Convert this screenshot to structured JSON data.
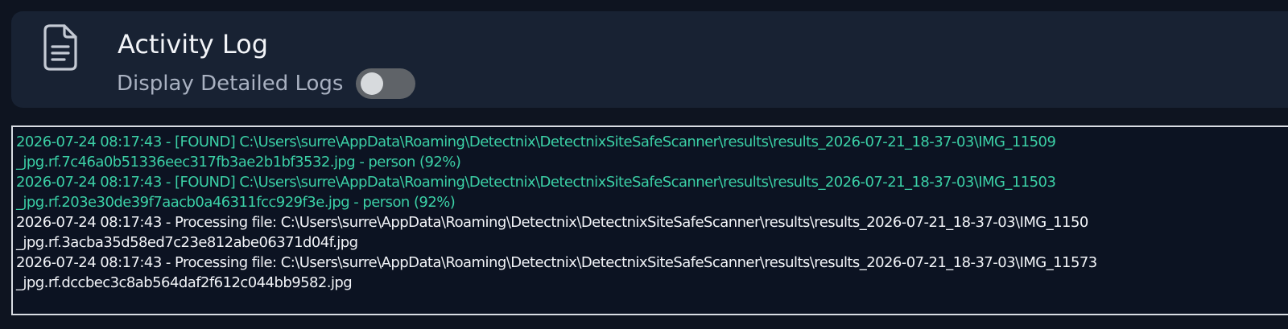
{
  "header": {
    "icon": "document-icon",
    "title": "Activity Log",
    "toggle_label": "Display Detailed Logs",
    "toggle_on": false
  },
  "colors": {
    "found": "#3bd0a6",
    "info": "#f2f4f8",
    "card": "#182233",
    "background": "#0e1420"
  },
  "log": {
    "lines": [
      {
        "type": "found",
        "text": "2026-07-24 08:17:43 - [FOUND] C:\\Users\\surre\\AppData\\Roaming\\Detectnix\\DetectnixSiteSafeScanner\\results\\results_2026-07-21_18-37-03\\IMG_11509"
      },
      {
        "type": "found",
        "text": "_jpg.rf.7c46a0b51336eec317fb3ae2b1bf3532.jpg - person (92%)"
      },
      {
        "type": "found",
        "text": "2026-07-24 08:17:43 - [FOUND] C:\\Users\\surre\\AppData\\Roaming\\Detectnix\\DetectnixSiteSafeScanner\\results\\results_2026-07-21_18-37-03\\IMG_11503"
      },
      {
        "type": "found",
        "text": "_jpg.rf.203e30de39f7aacb0a46311fcc929f3e.jpg - person (92%)"
      },
      {
        "type": "info",
        "text": "2026-07-24 08:17:43 - Processing file: C:\\Users\\surre\\AppData\\Roaming\\Detectnix\\DetectnixSiteSafeScanner\\results\\results_2026-07-21_18-37-03\\IMG_1150"
      },
      {
        "type": "info",
        "text": "_jpg.rf.3acba35d58ed7c23e812abe06371d04f.jpg"
      },
      {
        "type": "info",
        "text": "2026-07-24 08:17:43 - Processing file: C:\\Users\\surre\\AppData\\Roaming\\Detectnix\\DetectnixSiteSafeScanner\\results\\results_2026-07-21_18-37-03\\IMG_11573"
      },
      {
        "type": "info",
        "text": "_jpg.rf.dccbec3c8ab564daf2f612c044bb9582.jpg"
      }
    ]
  }
}
